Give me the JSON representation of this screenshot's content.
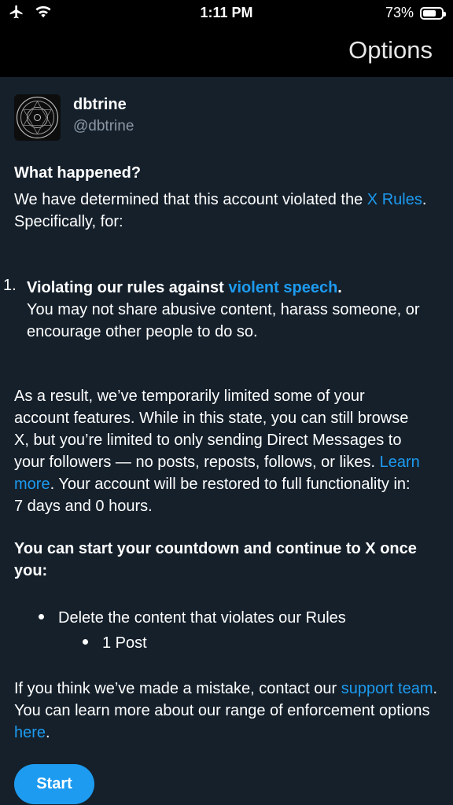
{
  "status_bar": {
    "time": "1:11 PM",
    "battery": "73%",
    "battery_level": 0.73
  },
  "header": {
    "title": "Options"
  },
  "profile": {
    "name": "dbtrine",
    "handle": "@dbtrine"
  },
  "notice": {
    "heading": "What happened?",
    "intro_pre": "We have determined that this account violated the ",
    "intro_link": "X Rules",
    "intro_post": ". Specifically, for:",
    "violation_number": "1.",
    "violation_title_pre": "Violating our rules against ",
    "violation_title_link": "violent speech",
    "violation_title_post": ".",
    "violation_desc": "You may not share abusive content, harass someone, or encourage other people to do so.",
    "result_pre": "As a result, we’ve temporarily limited some of your account features. While in this state, you can still browse X, but you’re limited to only sending Direct Messages to your followers — no posts, reposts, follows, or likes. ",
    "result_link": "Learn more",
    "result_post": ". Your account will be restored to full functionality in: 7 days and 0 hours.",
    "countdown_heading": "You can start your countdown and continue to X once you:",
    "bullet_1": "Delete the content that violates our Rules",
    "bullet_1_sub": "1 Post",
    "mistake_pre": "If you think we’ve made a mistake, contact our ",
    "mistake_link": "support team",
    "mistake_mid": ". You can learn more about our range of enforcement options ",
    "mistake_link2": "here",
    "mistake_post": "."
  },
  "actions": {
    "start_label": "Start"
  },
  "colors": {
    "background": "#15202b",
    "accent": "#1d9bf0",
    "bar": "#000000"
  }
}
